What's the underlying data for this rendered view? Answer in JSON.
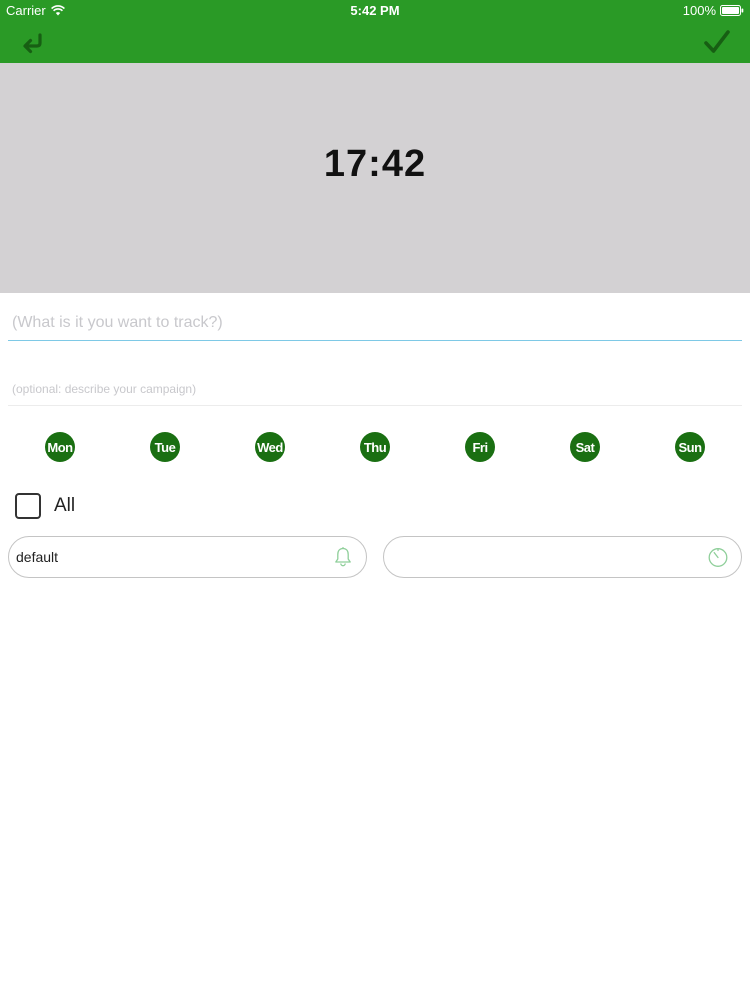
{
  "status_bar": {
    "carrier": "Carrier",
    "time": "5:42 PM",
    "battery": "100%"
  },
  "nav": {
    "back_icon": "back-arrow-icon",
    "done_icon": "checkmark-icon"
  },
  "time_display": "17:42",
  "form": {
    "title_placeholder": "(What is it you want to track?)",
    "description_placeholder": "(optional: describe your campaign)"
  },
  "days": [
    {
      "label": "Mon"
    },
    {
      "label": "Tue"
    },
    {
      "label": "Wed"
    },
    {
      "label": "Thu"
    },
    {
      "label": "Fri"
    },
    {
      "label": "Sat"
    },
    {
      "label": "Sun"
    }
  ],
  "all_checkbox": {
    "label": "All",
    "checked": false
  },
  "reminder_field": {
    "value": "default",
    "icon": "bell-icon"
  },
  "timer_field": {
    "value": "",
    "icon": "timer-icon"
  },
  "colors": {
    "header_green": "#2a9a26",
    "day_green": "#1a6f12",
    "panel_gray": "#d3d1d3",
    "input_underline": "#7ec9e6",
    "icon_green": "#8fcf9a"
  }
}
